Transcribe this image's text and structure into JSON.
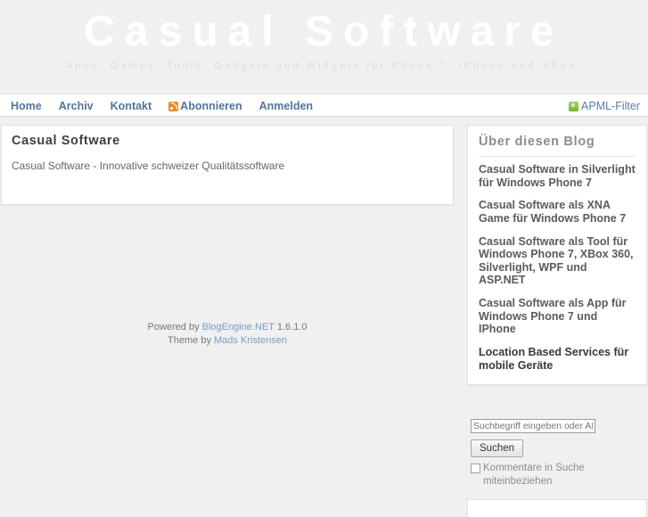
{
  "header": {
    "title": "Casual Software",
    "subtitle": "Apps, Games, Tools, Gadgets und Widgets für Phone 7, IPhone und XBox."
  },
  "nav": {
    "items": [
      {
        "label": "Home",
        "icon": null
      },
      {
        "label": "Archiv",
        "icon": null
      },
      {
        "label": "Kontakt",
        "icon": null
      },
      {
        "label": "Abonnieren",
        "icon": "rss-icon"
      },
      {
        "label": "Anmelden",
        "icon": null
      }
    ],
    "right": {
      "label": "APML-Filter",
      "icon": "apml-green-icon"
    }
  },
  "post": {
    "title": "Casual Software",
    "body": "Casual Software - Innovative schweizer Qualitätssoftware"
  },
  "footer": {
    "powered_prefix": "Powered by",
    "engine_link": "BlogEngine.NET",
    "version": "1.6.1.0",
    "theme_prefix": "Theme by",
    "theme_author": "Mads Kristensen"
  },
  "sidebar": {
    "about": {
      "header": "Über diesen Blog",
      "items": [
        {
          "label": "Casual Software in Silverlight für Windows Phone 7",
          "current": false
        },
        {
          "label": "Casual Software als XNA Game für Windows Phone 7",
          "current": false
        },
        {
          "label": "Casual Software als Tool für Windows Phone 7, XBox 360, Silverlight, WPF und ASP.NET",
          "current": false
        },
        {
          "label": "Casual Software als App für Windows Phone 7 und IPhone",
          "current": false
        },
        {
          "label": "Location Based Services für mobile Geräte",
          "current": true
        }
      ]
    },
    "search": {
      "input_value": "",
      "placeholder": "Suchbegriff eingeben oder APML URL",
      "button_label": "Suchen",
      "checkbox_label": "Kommentare in Suche miteinbeziehen",
      "checkbox_checked": false
    }
  },
  "colors": {
    "page_background": "#f0f0f0",
    "box_background": "#ffffff",
    "box_border": "#e0e0e0",
    "nav_link": "#52749b",
    "title_text": "#ffffff",
    "subtitle_text": "#dcdcdc",
    "widget_header": "#8c8c8c",
    "rss_orange": "#ef8b27",
    "apml_green": "#85c341",
    "footer_link": "#7b9bc4"
  }
}
